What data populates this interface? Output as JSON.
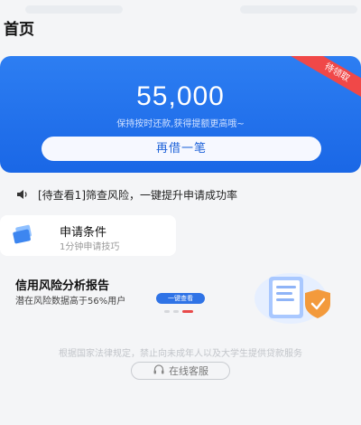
{
  "header": {
    "title": "首页"
  },
  "hero": {
    "badge": "待领取",
    "amount": "55,000",
    "subtitle": "保持按时还款,获得提额更高哦~",
    "button_label": "再借一笔",
    "colors": {
      "primary": "#1a67e6",
      "badge": "#f04848"
    }
  },
  "notice": {
    "icon": "speaker-icon",
    "text": "[待查看1]筛查风险，一键提升申请成功率"
  },
  "apply_card": {
    "icon": "card-icon",
    "title": "申请条件",
    "subtitle": "1分钟申请技巧"
  },
  "report": {
    "title": "信用风险分析报告",
    "subtitle": "潜在风险数据高于56%用户",
    "button_label": "一键查看",
    "icon": "report-shield-icon",
    "pager": {
      "count": 3,
      "active": 3
    }
  },
  "footer": {
    "law_text": "根据国家法律规定，禁止向未成年人以及大学生提供贷款服务",
    "service_label": "在线客服",
    "service_icon": "headset-icon"
  }
}
